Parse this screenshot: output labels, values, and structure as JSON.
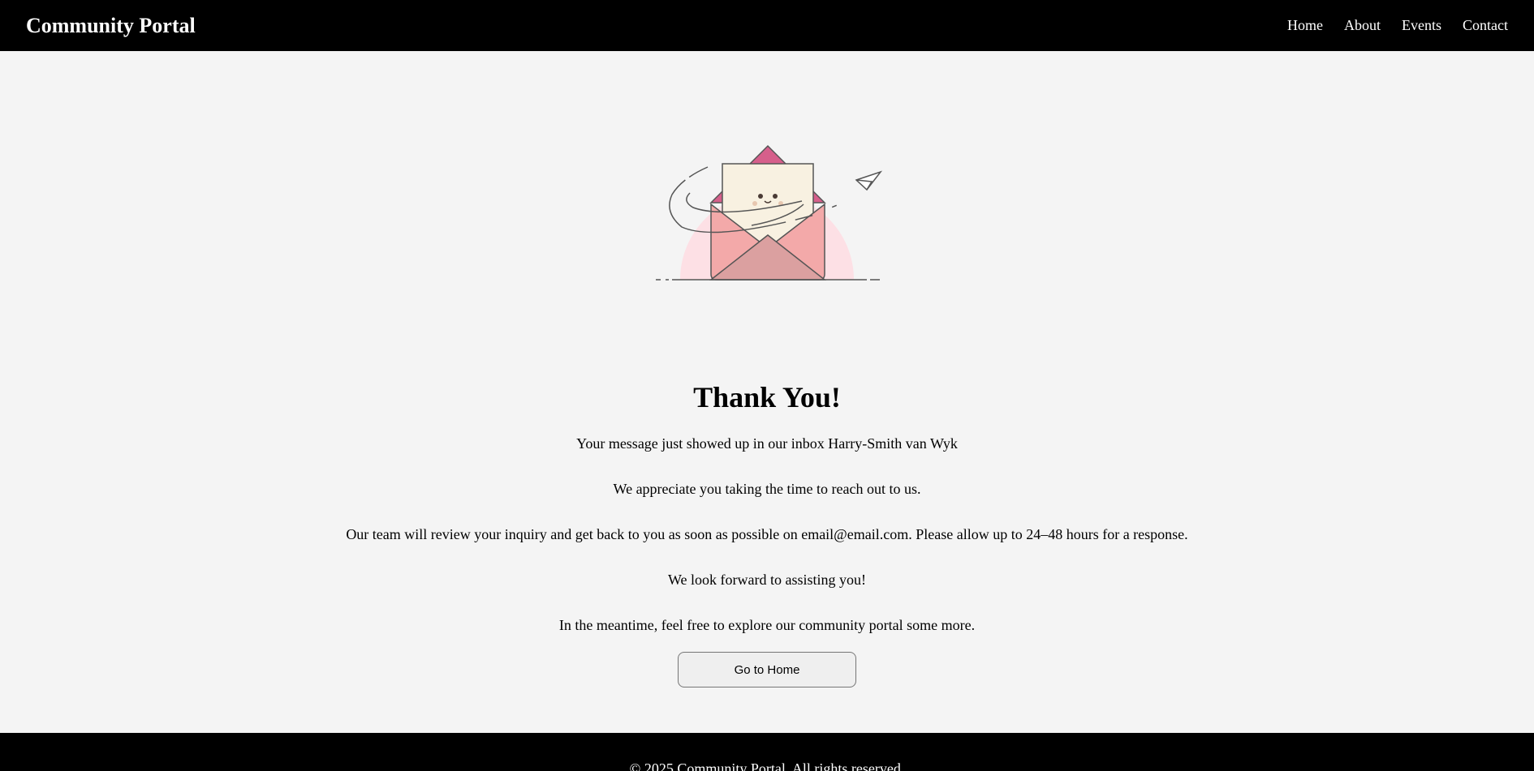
{
  "header": {
    "brand": "Community Portal",
    "nav": [
      {
        "label": "Home"
      },
      {
        "label": "About"
      },
      {
        "label": "Events"
      },
      {
        "label": "Contact"
      }
    ]
  },
  "illustration": {
    "icon": "open-envelope-with-paper-plane-icon",
    "accent": "#d65f8b",
    "envelope": "#f3a9a9",
    "letter": "#f8f1e1"
  },
  "main": {
    "title": "Thank You!",
    "lines": [
      "Your message just showed up in our inbox Harry-Smith van Wyk",
      "We appreciate you taking the time to reach out to us.",
      "Our team will review your inquiry and get back to you as soon as possible on email@email.com. Please allow up to 24–48 hours for a response.",
      "We look forward to assisting you!",
      "In the meantime, feel free to explore our community portal some more."
    ],
    "button_label": "Go to Home"
  },
  "footer": {
    "text": "© 2025 Community Portal. All rights reserved."
  }
}
